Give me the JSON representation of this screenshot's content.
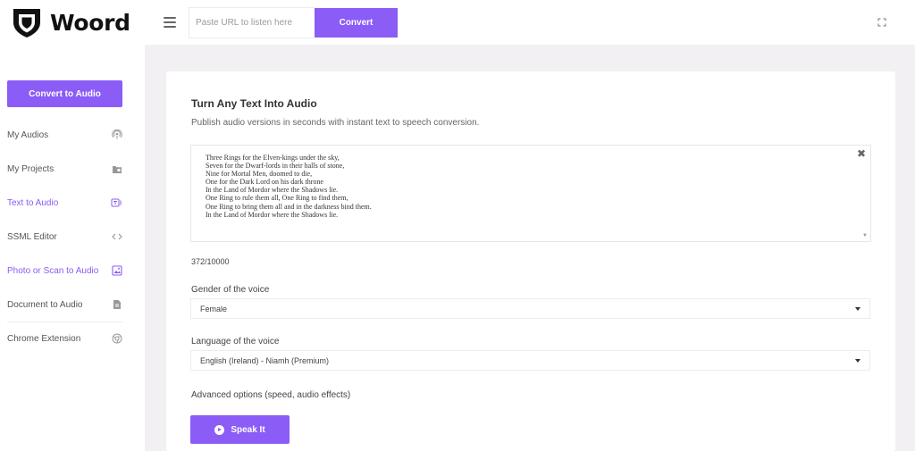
{
  "brand": {
    "name": "Woord"
  },
  "header": {
    "url_placeholder": "Paste URL to listen here",
    "convert_label": "Convert"
  },
  "sidebar": {
    "primary_label": "Convert to Audio",
    "items": [
      {
        "label": "My Audios",
        "icon": "podcast-icon"
      },
      {
        "label": "My Projects",
        "icon": "folder-icon"
      },
      {
        "label": "Text to Audio",
        "icon": "text-to-audio-icon",
        "active": true
      },
      {
        "label": "SSML Editor",
        "icon": "code-icon"
      },
      {
        "label": "Photo or Scan to Audio",
        "icon": "image-icon",
        "active": true
      },
      {
        "label": "Document to Audio",
        "icon": "document-icon"
      },
      {
        "label": "Chrome Extension",
        "icon": "chrome-icon"
      }
    ]
  },
  "main": {
    "title": "Turn Any Text Into Audio",
    "subtitle": "Publish audio versions in seconds with instant text to speech conversion.",
    "text": "Three Rings for the Elven-kings under the sky,\nSeven for the Dwarf-lords in their halls of stone,\nNine for Mortal Men, doomed to die,\nOne for the Dark Lord on his dark throne\nIn the Land of Mordor where the Shadows lie.\nOne Ring to rule them all, One Ring to find them,\nOne Ring to bring them all and in the darkness bind them.\nIn the Land of Mordor where the Shadows lie.",
    "char_count": "372/10000",
    "gender_label": "Gender of the voice",
    "gender_value": "Female",
    "language_label": "Language of the voice",
    "language_value": "English (Ireland) - Niamh (Premium)",
    "advanced_label": "Advanced options (speed, audio effects)",
    "speak_label": "Speak It"
  },
  "colors": {
    "accent": "#8b5cf6",
    "background": "#f3f0f4"
  }
}
